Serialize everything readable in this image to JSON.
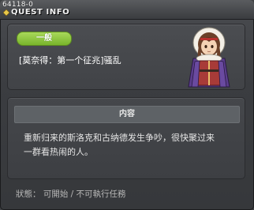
{
  "window": {
    "quest_id": "64118-0",
    "title": "QUEST INFO"
  },
  "quest": {
    "category": "一般",
    "name": "[莫奈得：第一个征兆]骚乱"
  },
  "content": {
    "header": "内容",
    "description_line1": "重新归来的斯洛克和古纳德发生争吵，很快聚过来",
    "description_line2": "一群看热闹的人。"
  },
  "status": {
    "text": "狀態： 可開始 / 不可執行任務"
  },
  "icons": {
    "title_icon": "diamond-icon",
    "portrait": "npc-portrait"
  },
  "colors": {
    "badge_green": "#8cc63f",
    "panel_bg": "#43454a",
    "content_header_bg": "#5e6266"
  }
}
